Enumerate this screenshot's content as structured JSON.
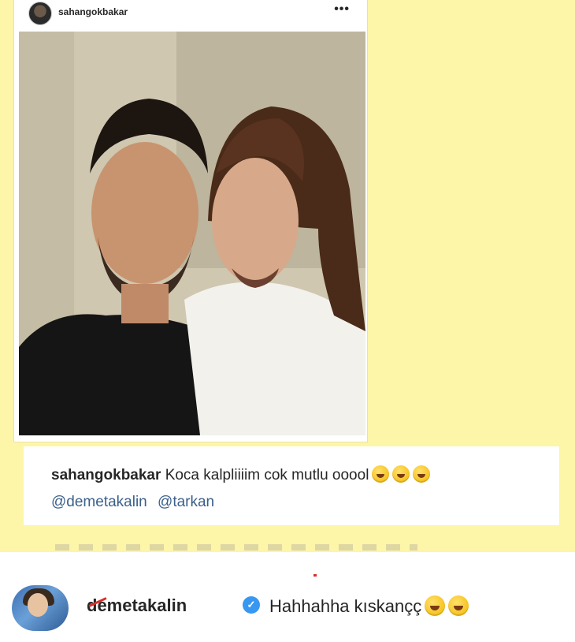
{
  "post": {
    "username": "sahangokbakar",
    "more_glyph": "•••"
  },
  "caption": {
    "username": "sahangokbakar",
    "text": "Koca kalpliiiim cok mutlu ooool",
    "emojis": [
      "rofl-emoji",
      "rofl-emoji",
      "rofl-emoji"
    ],
    "mentions": [
      "@demetakalin",
      "@tarkan"
    ]
  },
  "comment": {
    "username": "demetakalin",
    "verified": true,
    "text": "Hahhahha kıskançç",
    "emojis": [
      "joy-emoji",
      "joy-emoji"
    ]
  },
  "colors": {
    "background": "#fdf5a8",
    "mention": "#3b5f8a",
    "verified": "#3897f0",
    "annotation": "#d8302a"
  }
}
